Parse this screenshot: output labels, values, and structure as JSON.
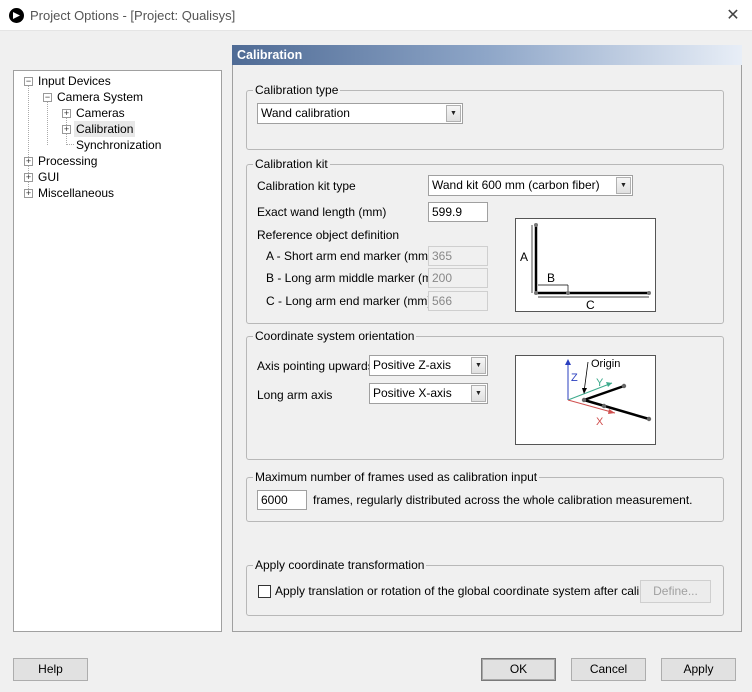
{
  "window": {
    "title": "Project Options - [Project: Qualisys]",
    "close_icon": "close-icon"
  },
  "tree": {
    "input_devices": "Input Devices",
    "camera_system": "Camera System",
    "cameras": "Cameras",
    "calibration": "Calibration",
    "synchronization": "Synchronization",
    "processing": "Processing",
    "gui": "GUI",
    "miscellaneous": "Miscellaneous",
    "expand_symbol": "+",
    "collapse_symbol": "−"
  },
  "panel": {
    "title": "Calibration"
  },
  "calibration_type": {
    "group_title": "Calibration type",
    "value": "Wand calibration"
  },
  "calibration_kit": {
    "group_title": "Calibration kit",
    "kit_type_label": "Calibration kit type",
    "kit_type_value": "Wand kit 600 mm (carbon fiber)",
    "wand_length_label": "Exact wand length (mm)",
    "wand_length_value": "599.9",
    "ref_object_label": "Reference object definition",
    "a_label": "A - Short arm end marker (mm)",
    "a_value": "365",
    "b_label": "B - Long arm middle marker (mm)",
    "b_value": "200",
    "c_label": "C - Long arm end marker (mm)",
    "c_value": "566",
    "diagram": {
      "a": "A",
      "b": "B",
      "c": "C"
    }
  },
  "coordinate_system": {
    "group_title": "Coordinate system orientation",
    "axis_up_label": "Axis pointing upwards",
    "axis_up_value": "Positive Z-axis",
    "long_arm_label": "Long arm axis",
    "long_arm_value": "Positive X-axis",
    "diagram": {
      "origin": "Origin",
      "x": "X",
      "y": "Y",
      "z": "Z"
    },
    "colors": {
      "x": "#d0504f",
      "y": "#3caa8c",
      "z": "#2a3fbf"
    }
  },
  "max_frames": {
    "group_title": "Maximum number of frames used as calibration input",
    "value": "6000",
    "suffix": "frames, regularly distributed across the whole calibration measurement."
  },
  "transform": {
    "group_title": "Apply coordinate transformation",
    "checkbox_label": "Apply translation or rotation of the global coordinate system after calibration",
    "checked": false,
    "define_button": "Define..."
  },
  "footer": {
    "help": "Help",
    "ok": "OK",
    "cancel": "Cancel",
    "apply": "Apply"
  }
}
